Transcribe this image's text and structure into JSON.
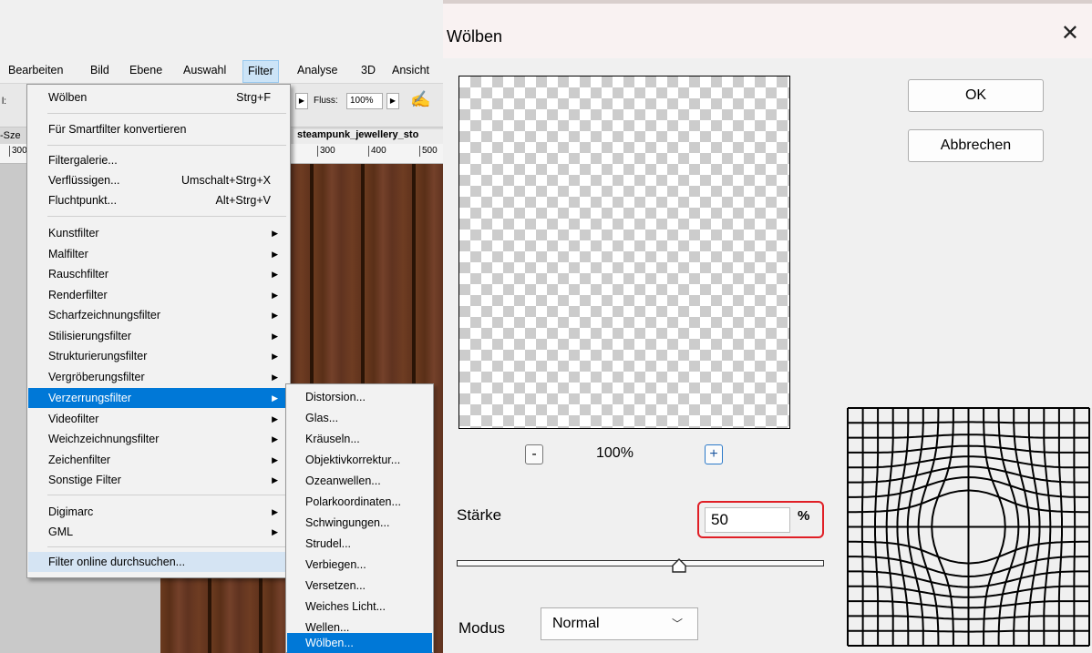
{
  "photoshop": {
    "menubar": [
      "Bearbeiten",
      "Bild",
      "Ebene",
      "Auswahl",
      "Filter",
      "Analyse",
      "3D",
      "Ansicht"
    ],
    "options": {
      "left_stub": "l:",
      "fluss_label": "Fluss:",
      "fluss_value": "100%"
    },
    "tabs": {
      "left": "-Sze",
      "document": "steampunk_jewellery_sto"
    },
    "ruler": [
      "300",
      "300",
      "400",
      "500"
    ],
    "filter_menu": {
      "items": [
        {
          "label": "Wölben",
          "shortcut": "Strg+F"
        },
        {
          "label": "Für Smartfilter konvertieren"
        },
        {
          "label": "Filtergalerie..."
        },
        {
          "label": "Verflüssigen...",
          "shortcut": "Umschalt+Strg+X"
        },
        {
          "label": "Fluchtpunkt...",
          "shortcut": "Alt+Strg+V"
        },
        {
          "label": "Kunstfilter"
        },
        {
          "label": "Malfilter"
        },
        {
          "label": "Rauschfilter"
        },
        {
          "label": "Renderfilter"
        },
        {
          "label": "Scharfzeichnungsfilter"
        },
        {
          "label": "Stilisierungsfilter"
        },
        {
          "label": "Strukturierungsfilter"
        },
        {
          "label": "Vergröberungsfilter"
        },
        {
          "label": "Verzerrungsfilter"
        },
        {
          "label": "Videofilter"
        },
        {
          "label": "Weichzeichnungsfilter"
        },
        {
          "label": "Zeichenfilter"
        },
        {
          "label": "Sonstige Filter"
        },
        {
          "label": "Digimarc"
        },
        {
          "label": "GML"
        },
        {
          "label": "Filter online durchsuchen..."
        }
      ]
    },
    "submenu": [
      "Distorsion...",
      "Glas...",
      "Kräuseln...",
      "Objektivkorrektur...",
      "Ozeanwellen...",
      "Polarkoordinaten...",
      "Schwingungen...",
      "Strudel...",
      "Verbiegen...",
      "Versetzen...",
      "Weiches Licht...",
      "Wellen...",
      "Wölben..."
    ]
  },
  "dialog": {
    "title": "Wölben",
    "close": "✕",
    "ok": "OK",
    "cancel": "Abbrechen",
    "zoom_minus": "-",
    "zoom_value": "100%",
    "zoom_plus": "+",
    "staerke_label": "Stärke",
    "staerke_value": "50",
    "staerke_unit": "%",
    "slider_value": 50,
    "slider_range": [
      -100,
      100
    ],
    "modus_label": "Modus",
    "modus_value": "Normal",
    "highlight_color": "#e01f26"
  }
}
